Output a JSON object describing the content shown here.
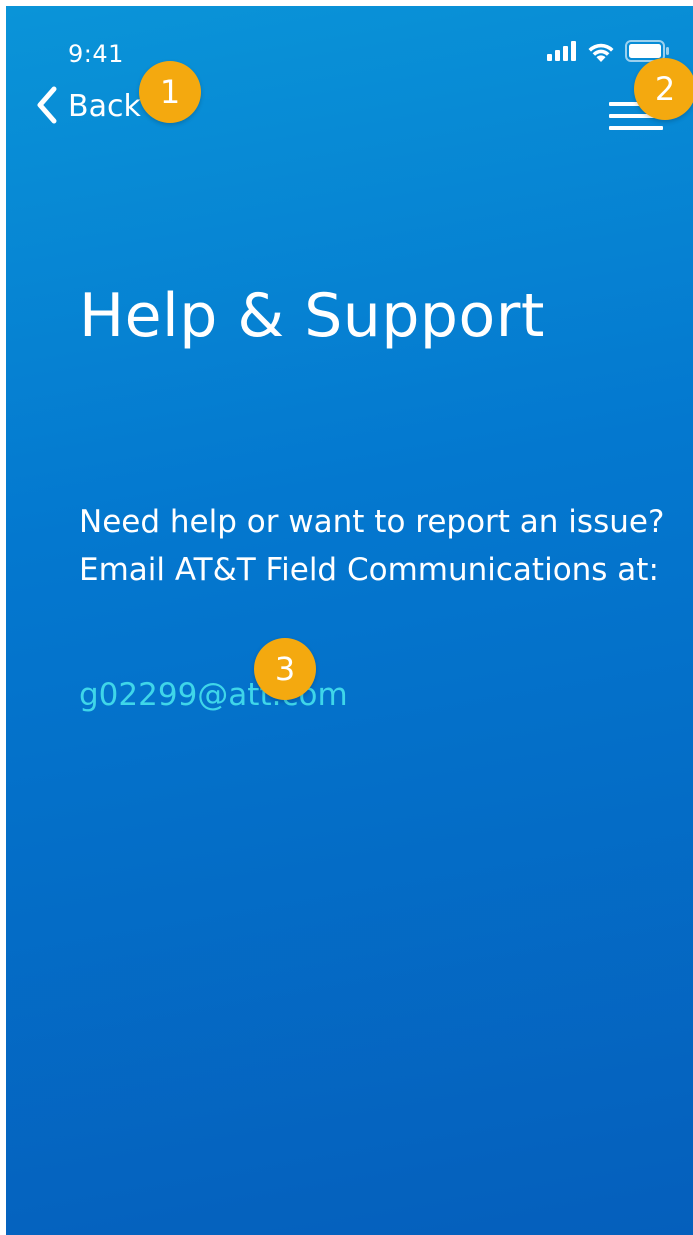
{
  "status_bar": {
    "time": "9:41",
    "icons": [
      "cellular-signal-icon",
      "wifi-icon",
      "battery-icon"
    ]
  },
  "nav": {
    "back_label": "Back",
    "back_icon": "chevron-left-icon",
    "menu_icon": "hamburger-menu-icon"
  },
  "annotations": {
    "badge_1": "1",
    "badge_2": "2",
    "badge_3": "3",
    "badge_color": "#f4a90f"
  },
  "main": {
    "title": "Help & Support",
    "help_line_1": "Need help or want to report an issue?",
    "help_line_2": "Email AT&T Field Communications at:",
    "email": "g02299@att.com"
  },
  "colors": {
    "background_top": "#0a94d8",
    "background_bottom": "#055fbc",
    "link": "#3fd6e9",
    "text": "#ffffff"
  }
}
